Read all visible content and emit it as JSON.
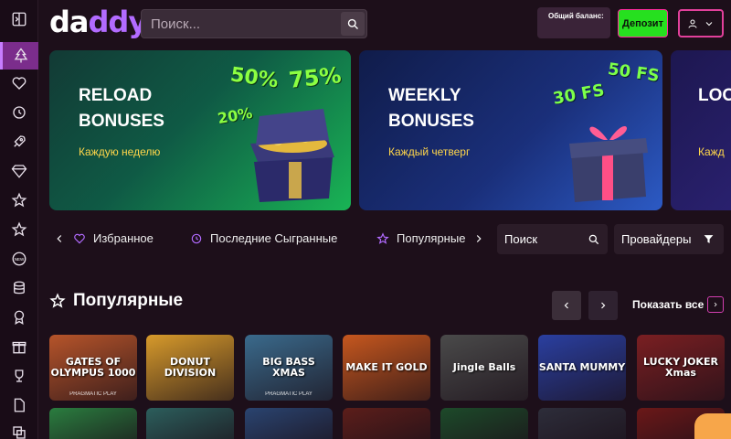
{
  "header": {
    "logo": {
      "part1": "da",
      "part2": "ddy"
    },
    "search_placeholder": "Поиск...",
    "balance_label": "Общий баланс:",
    "deposit_label": "Депозит"
  },
  "sidebar": {
    "items": [
      {
        "icon": "collapse-icon"
      },
      {
        "icon": "tree-icon",
        "active": true
      },
      {
        "icon": "heart-icon"
      },
      {
        "icon": "history-icon"
      },
      {
        "icon": "rocket-icon"
      },
      {
        "icon": "diamond-icon"
      },
      {
        "icon": "star-icon"
      },
      {
        "icon": "new-badge-icon"
      },
      {
        "icon": "database-icon"
      },
      {
        "icon": "award-icon"
      },
      {
        "icon": "gift-icon"
      },
      {
        "icon": "trophy-icon"
      },
      {
        "icon": "document-icon"
      },
      {
        "icon": "copy-icon"
      }
    ]
  },
  "banners": [
    {
      "title": "RELOAD\nBONUSES",
      "subtitle": "Каждую неделю",
      "tags": [
        "20%",
        "50%",
        "75%"
      ]
    },
    {
      "title": "WEEKLY\nBONUSES",
      "subtitle": "Каждый четверг",
      "tags": [
        "30 FS",
        "50 FS"
      ]
    },
    {
      "title": "LOO",
      "subtitle": "Кажд"
    }
  ],
  "filters": {
    "favorites": "Избранное",
    "recent": "Последние Сыгранные",
    "popular": "Популярные",
    "search": "Поиск",
    "providers": "Провайдеры"
  },
  "section": {
    "title": "Популярные",
    "show_all": "Показать все"
  },
  "games_row1": [
    {
      "name": "GATES OF OLYMPUS 1000",
      "provider": "PRAGMATIC PLAY",
      "color": "#b6542a"
    },
    {
      "name": "DONUT DIVISION",
      "color": "#d79a2b"
    },
    {
      "name": "BIG BASS XMAS",
      "provider": "PRAGMATIC PLAY",
      "color": "#3a6a8c"
    },
    {
      "name": "MAKE IT GOLD",
      "color": "#c6571e"
    },
    {
      "name": "Jingle Balls",
      "color": "#4a4a4a"
    },
    {
      "name": "SANTA MUMMY",
      "color": "#2a3fa0"
    },
    {
      "name": "LUCKY JOKER Xmas",
      "color": "#7a1f22"
    }
  ],
  "games_row2": [
    {
      "color": "#2a7d3f"
    },
    {
      "color": "#2c5e5c"
    },
    {
      "color": "#2a4470"
    },
    {
      "color": "#5c1e1a"
    },
    {
      "color": "#1d4a2a"
    },
    {
      "color": "#2d2d3a"
    },
    {
      "color": "#6b1818"
    }
  ]
}
